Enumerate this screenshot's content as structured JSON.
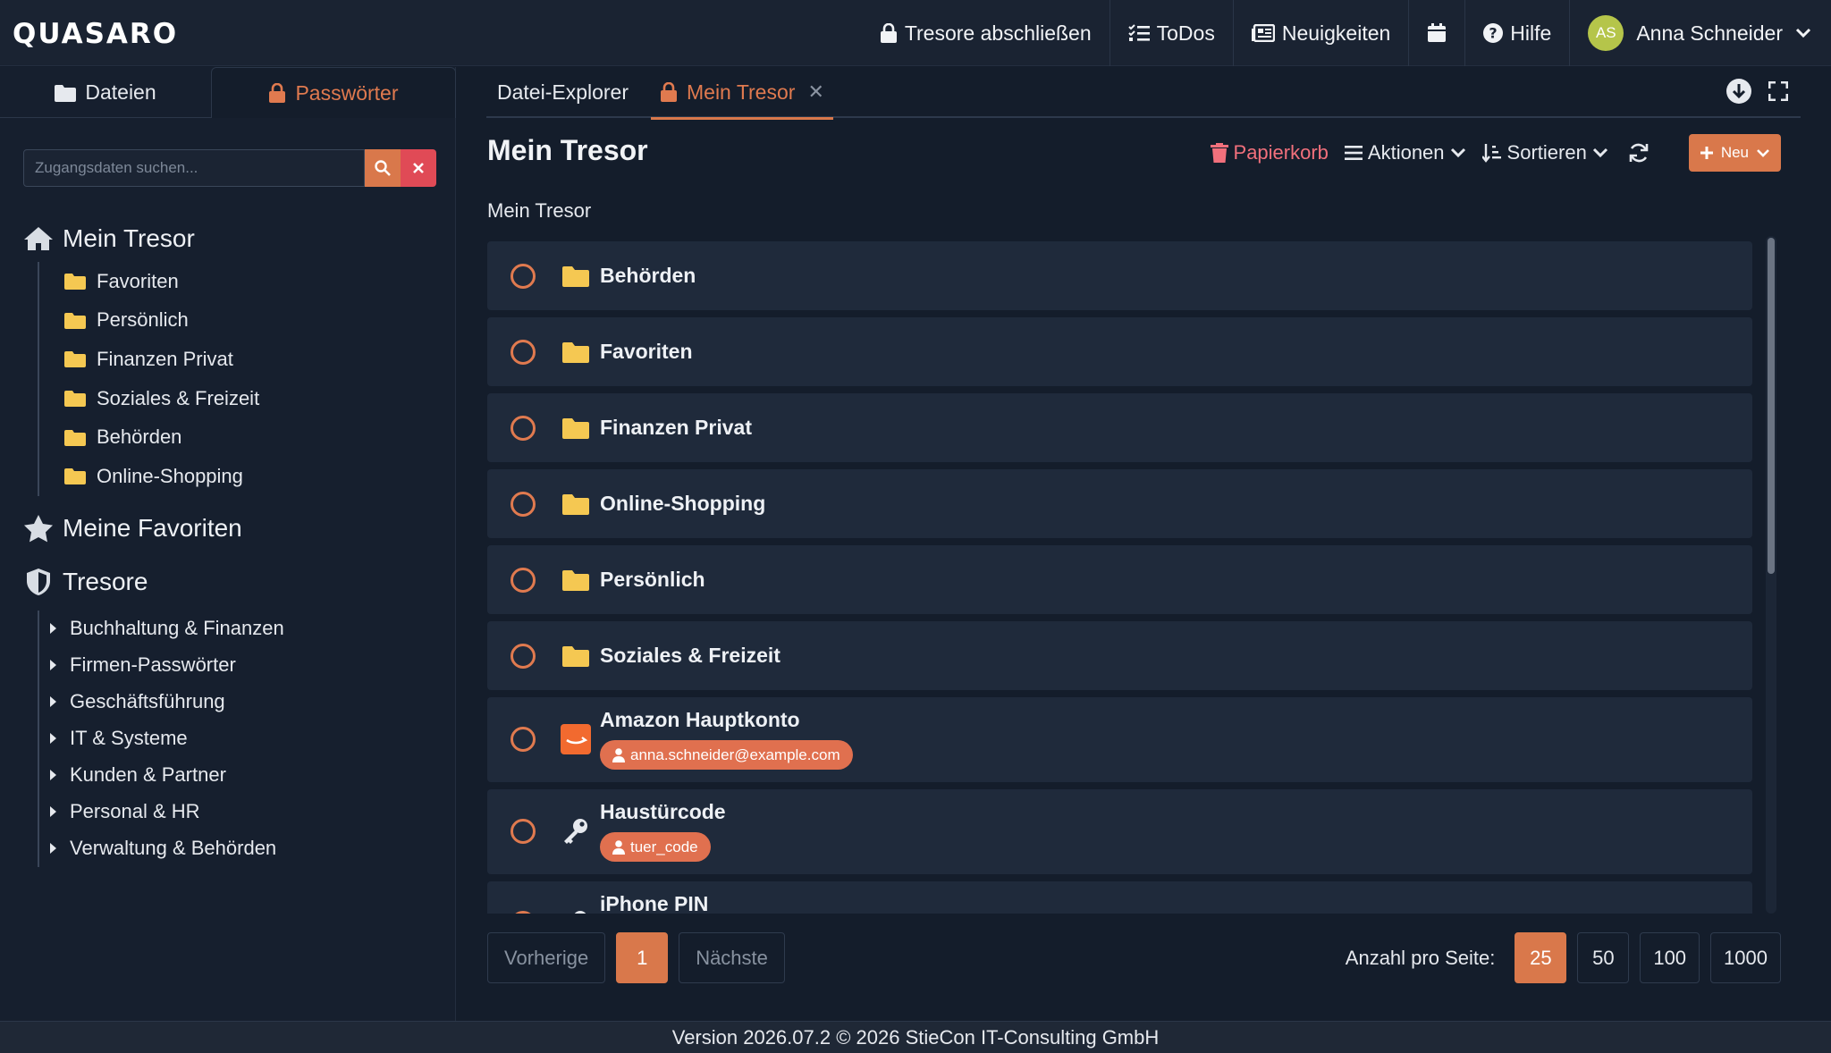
{
  "app": {
    "logo_text": "QUASARO"
  },
  "navbar": {
    "lock_vaults": "Tresore abschließen",
    "todos": "ToDos",
    "news": "Neuigkeiten",
    "help": "Hilfe",
    "user_initials": "AS",
    "user_name": "Anna Schneider"
  },
  "left": {
    "tabs": [
      "Dateien",
      "Passwörter"
    ],
    "search": {
      "placeholder": "Zugangsdaten suchen..."
    },
    "my_vault": "Mein Tresor",
    "my_vault_children": [
      "Favoriten",
      "Persönlich",
      "Finanzen Privat",
      "Soziales & Freizeit",
      "Behörden",
      "Online-Shopping"
    ],
    "my_favorites": "Meine Favoriten",
    "vaults": "Tresore",
    "vault_children": [
      "Buchhaltung & Finanzen",
      "Firmen-Passwörter",
      "Geschäftsführung",
      "IT & Systeme",
      "Kunden & Partner",
      "Personal & HR",
      "Verwaltung & Behörden"
    ]
  },
  "main": {
    "tabs": [
      "Datei-Explorer",
      "Mein Tresor"
    ],
    "title": "Mein Tresor",
    "toolbar": {
      "trash": "Papierkorb",
      "actions": "Aktionen",
      "sort": "Sortieren",
      "new": "Neu"
    },
    "breadcrumb": "Mein Tresor",
    "folders": [
      "Behörden",
      "Favoriten",
      "Finanzen Privat",
      "Online-Shopping",
      "Persönlich",
      "Soziales & Freizeit"
    ],
    "entries": [
      {
        "name": "Amazon Hauptkonto",
        "user": "anna.schneider@example.com",
        "icon": "amazon-icon"
      },
      {
        "name": "Haustürcode",
        "user": "tuer_code",
        "icon": "key-icon"
      },
      {
        "name": "iPhone PIN",
        "icon": "key-icon"
      }
    ]
  },
  "pagination": {
    "prev": "Vorherige",
    "current": "1",
    "next": "Nächste",
    "per_page_label": "Anzahl pro Seite:",
    "per_page_options": [
      "25",
      "50",
      "100",
      "1000"
    ],
    "per_page_selected": "25"
  },
  "footer": {
    "text": "Version 2026.07.2 © 2026 StieCon IT-Consulting GmbH"
  },
  "colors": {
    "accent": "#d9784b",
    "danger": "#e04a56",
    "background": "#141d2b",
    "row": "#1f2a3b"
  }
}
